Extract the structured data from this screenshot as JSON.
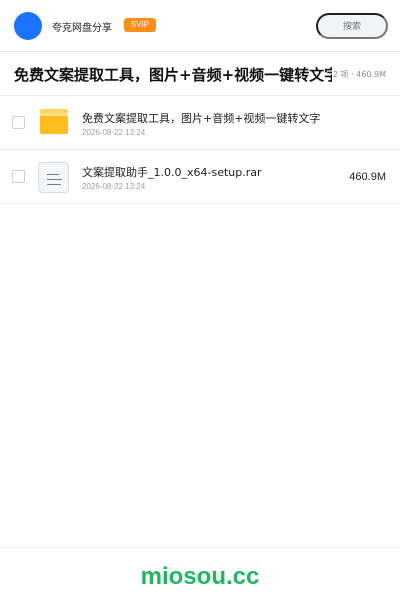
{
  "header": {
    "brand_name": "夸克网盘分享",
    "vip_badge": "SVIP",
    "search_placeholder": "搜索",
    "avatar_color": "#1b73ff",
    "vip_color": "#ff8d1a"
  },
  "share": {
    "title": "免费文案提取工具，图片+音频+视频一键转文字",
    "meta": "2 项 · 460.9M"
  },
  "files": [
    {
      "type": "folder",
      "icon": "folder-icon",
      "name": "免费文案提取工具，图片+音频+视频一键转文字",
      "date": "2026-08-22 13:24",
      "size": ""
    },
    {
      "type": "file",
      "icon": "document-file-icon",
      "name": "文案提取助手_1.0.0_x64-setup.rar",
      "date": "2026-08-22 13:24",
      "size": "460.9M"
    }
  ],
  "footer": {
    "watermark": "miosou.cc",
    "watermark_color": "#1db85f"
  }
}
